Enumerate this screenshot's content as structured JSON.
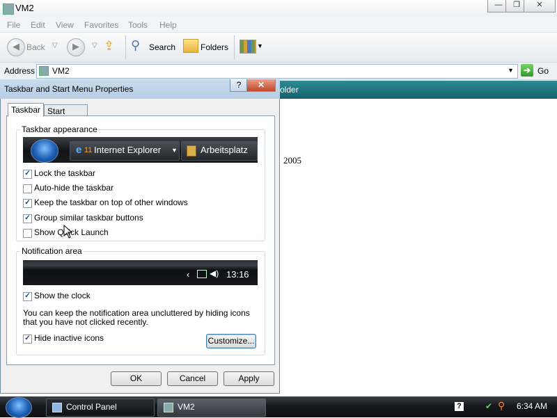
{
  "window": {
    "title": "VM2",
    "controls": {
      "minimize": "—",
      "maximize": "❐",
      "close": "✕"
    }
  },
  "menu": [
    "File",
    "Edit",
    "View",
    "Favorites",
    "Tools",
    "Help"
  ],
  "toolbar": {
    "back": "Back",
    "search": "Search",
    "folders": "Folders"
  },
  "address": {
    "label": "Address",
    "value": "VM2",
    "go": "Go"
  },
  "background_content": {
    "header_fragment": "older",
    "text_fragment": "2005"
  },
  "dialog": {
    "title": "Taskbar and Start Menu Properties",
    "help": "?",
    "close": "✕",
    "tabs": [
      {
        "label": "Taskbar",
        "active": true
      },
      {
        "label": "Start Menu",
        "active": false
      }
    ],
    "appearance": {
      "label": "Taskbar appearance",
      "preview_buttons": [
        "Internet Explorer",
        "Arbeitsplatz"
      ],
      "preview_count": "11",
      "options": [
        {
          "label": "Lock the taskbar",
          "checked": true
        },
        {
          "label": "Auto-hide the taskbar",
          "checked": false
        },
        {
          "label": "Keep the taskbar on top of other windows",
          "checked": true
        },
        {
          "label": "Group similar taskbar buttons",
          "checked": true
        },
        {
          "label": "Show Quick Launch",
          "checked": false
        }
      ]
    },
    "notification": {
      "label": "Notification area",
      "preview_time": "13:16",
      "show_clock": {
        "label": "Show the clock",
        "checked": true
      },
      "description": "You can keep the notification area uncluttered by hiding icons that you have not clicked recently.",
      "hide_inactive": {
        "label": "Hide inactive icons",
        "checked": true
      },
      "customize": "Customize..."
    },
    "buttons": {
      "ok": "OK",
      "cancel": "Cancel",
      "apply": "Apply"
    }
  },
  "taskbar": {
    "items": [
      "Control Panel",
      "VM2"
    ],
    "tray_help": "?",
    "clock": "6:34 AM"
  },
  "colors": {
    "content_header": "#1f6f79",
    "taskbar": "#15171b"
  }
}
